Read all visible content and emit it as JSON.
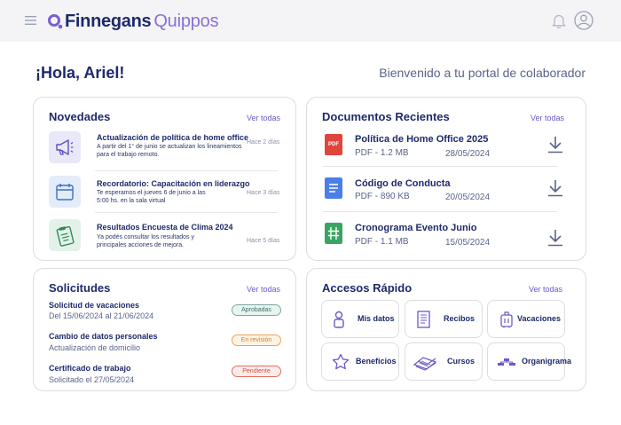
{
  "brand": {
    "name_a": "Finnegans",
    "name_b": "Quippos"
  },
  "header": {
    "greeting": "¡Hola, Ariel!",
    "welcome": "Bienvenido a tu portal de colaborador"
  },
  "novedades": {
    "title": "Novedades",
    "link": "Ver todas",
    "items": [
      {
        "title": "Actualización de política de home office",
        "desc": "A partir del 1° de junio se actualizan los lineamientos para el trabajo remoto.",
        "time": "Hace 2 días",
        "icon": "megaphone-icon"
      },
      {
        "title": "Recordatorio: Capacitación en liderazgo",
        "desc": "Te esperamos el jueves 6 de junio a las 5:00 hs. en la sala virtual",
        "time": "Hace 3 días",
        "icon": "calendar-icon"
      },
      {
        "title": "Resultados Encuesta de Clima 2024",
        "desc": "Ya podés consultar los resultados y principales acciones de mejora.",
        "time": "Hace 5 días",
        "icon": "clipboard-icon"
      }
    ]
  },
  "documentos": {
    "title": "Documentos Recientes",
    "link": "Ver todas",
    "items": [
      {
        "title": "Política de Home Office 2025",
        "meta": "PDF - 1.2 MB",
        "date": "28/05/2024",
        "icon_label": "PDF",
        "icon_color": "#e0453c"
      },
      {
        "title": "Código de Conducta",
        "meta": "PDF - 890 KB",
        "date": "20/05/2024",
        "icon_label": "",
        "icon_color": "#4a7ee8"
      },
      {
        "title": "Cronograma Evento Junio",
        "meta": "PDF - 1.1 MB",
        "date": "15/05/2024",
        "icon_label": "",
        "icon_color": "#3aa562"
      }
    ]
  },
  "solicitudes": {
    "title": "Solicitudes",
    "link": "Ver todas",
    "items": [
      {
        "title": "Solicitud de vacaciones",
        "sub": "Del 15/06/2024 al 21/06/2024",
        "status": "Aprobadas"
      },
      {
        "title": "Cambio de datos personales",
        "sub": "Actualización de domicilio",
        "status": "En revisión"
      },
      {
        "title": "Certificado de trabajo",
        "sub": "Solicitado el 27/05/2024",
        "status": "Pendiente"
      }
    ]
  },
  "accesos": {
    "title": "Accesos Rápido",
    "link": "Ver todas",
    "tiles": [
      {
        "label": "Mis datos",
        "icon": "person-icon"
      },
      {
        "label": "Recibos",
        "icon": "receipt-icon"
      },
      {
        "label": "Vacaciones",
        "icon": "suitcase-icon"
      },
      {
        "label": "Beneficios",
        "icon": "star-icon"
      },
      {
        "label": "Cursos",
        "icon": "books-icon"
      },
      {
        "label": "Organigrama",
        "icon": "org-chart-icon"
      }
    ]
  }
}
